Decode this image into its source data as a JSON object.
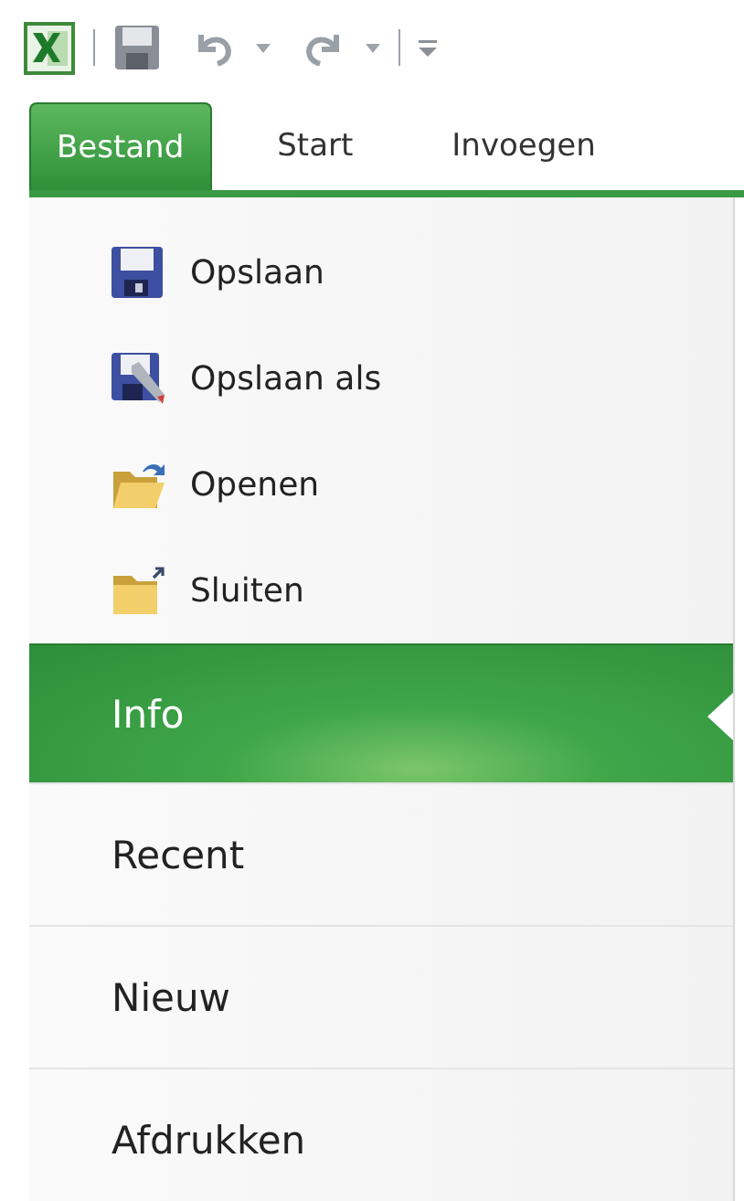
{
  "tabs": [
    {
      "label": "Bestand",
      "selected": true
    },
    {
      "label": "Start",
      "selected": false
    },
    {
      "label": "Invoegen",
      "selected": false
    }
  ],
  "menu": {
    "items": [
      {
        "kind": "command",
        "label": "Opslaan",
        "selected": false
      },
      {
        "kind": "command",
        "label": "Opslaan als",
        "selected": false
      },
      {
        "kind": "command",
        "label": "Openen",
        "selected": false
      },
      {
        "kind": "command",
        "label": "Sluiten",
        "selected": false
      },
      {
        "kind": "page",
        "label": "Info",
        "selected": true
      },
      {
        "kind": "page",
        "label": "Recent",
        "selected": false
      },
      {
        "kind": "page",
        "label": "Nieuw",
        "selected": false
      },
      {
        "kind": "page",
        "label": "Afdrukken",
        "selected": false
      }
    ]
  }
}
